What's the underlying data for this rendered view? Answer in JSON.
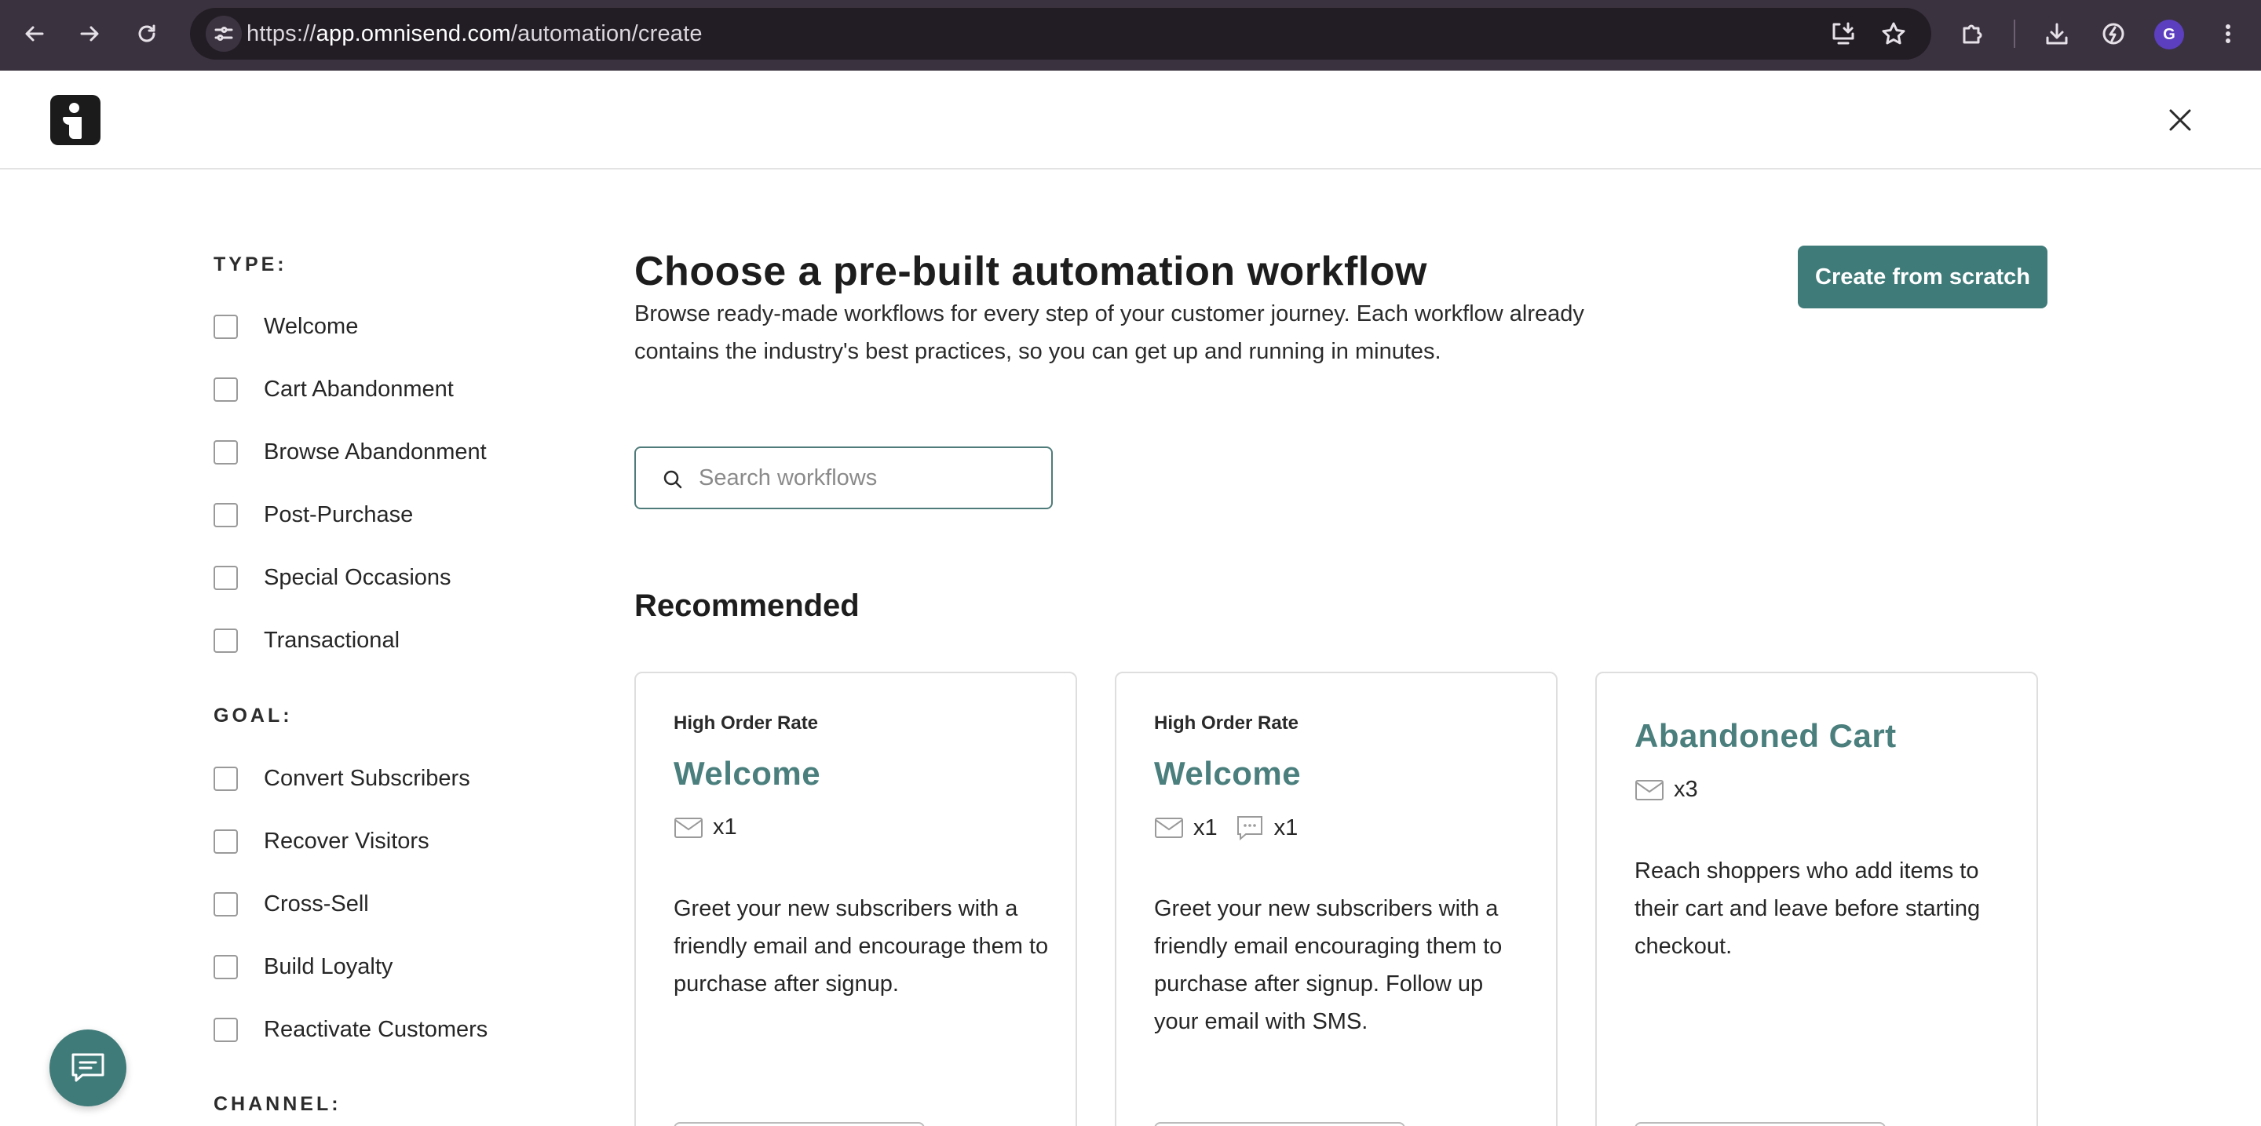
{
  "browser": {
    "url_prefix": "https://",
    "url_host": "app.omnisend.com",
    "url_path": "/automation/create",
    "profile_initial": "G"
  },
  "sidebar": {
    "type_title": "TYPE:",
    "type_items": [
      "Welcome",
      "Cart Abandonment",
      "Browse Abandonment",
      "Post-Purchase",
      "Special Occasions",
      "Transactional"
    ],
    "goal_title": "GOAL:",
    "goal_items": [
      "Convert Subscribers",
      "Recover Visitors",
      "Cross-Sell",
      "Build Loyalty",
      "Reactivate Customers"
    ],
    "channel_title": "CHANNEL:"
  },
  "main": {
    "title": "Choose a pre-built automation workflow",
    "description": "Browse ready-made workflows for every step of your customer journey. Each workflow already contains the industry's best practices, so you can get up and running in minutes.",
    "create_button": "Create from scratch",
    "search_placeholder": "Search workflows",
    "recommended_title": "Recommended"
  },
  "cards": [
    {
      "tag": "High Order Rate",
      "title": "Welcome",
      "email_count": "x1",
      "sms_count": "",
      "description": "Greet your new subscribers with a friendly email and encourage them to purchase after signup."
    },
    {
      "tag": "High Order Rate",
      "title": "Welcome",
      "email_count": "x1",
      "sms_count": "x1",
      "description": "Greet your new subscribers with a friendly email encouraging them to purchase after signup. Follow up your email with SMS."
    },
    {
      "tag": "",
      "title": "Abandoned Cart",
      "email_count": "x3",
      "sms_count": "",
      "description": "Reach shoppers who add items to their cart and leave before starting checkout."
    }
  ],
  "colors": {
    "accent": "#3f7b79",
    "card_title": "#4a7f7d",
    "chrome": "#3b323f"
  }
}
